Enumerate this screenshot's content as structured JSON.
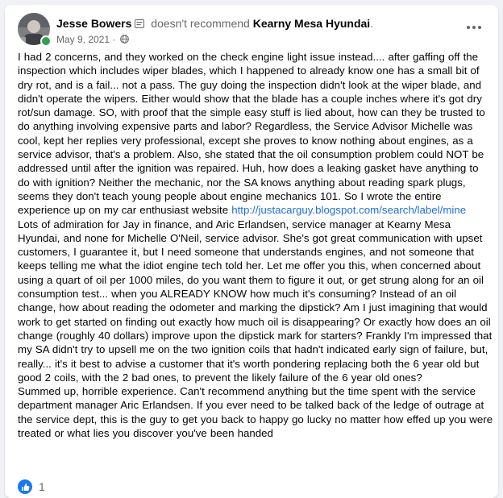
{
  "review": {
    "author": "Jesse Bowers",
    "action": "doesn't recommend",
    "business": "Kearny Mesa Hyundai",
    "date": "May 9, 2021",
    "separator": "·",
    "paragraph1_part1": "I had 2 concerns, and they worked on the check engine light issue instead.... after gaffing off the inspection which includes wiper blades, which I happened to already know one has a small bit of dry rot, and is a fail... not a pass. The guy doing the inspection didn't look at the wiper blade, and didn't operate the wipers. Either would show that the blade has a couple inches where it's got dry rot/sun damage. SO, with proof that the simple easy stuff is lied about, how can they be trusted to do anything involving expensive parts and labor? Regardless, the Service Advisor Michelle was cool, kept her replies very professional, except she proves to know nothing about engines, as a service advisor, that's a problem. Also, she stated that the oil consumption problem could NOT be addressed until after the ignition was repaired. Huh, how does a leaking gasket have anything to do with ignition? Neither the mechanic, nor the SA knows anything about reading spark plugs, seems they don't teach young people about engine mechanics 101. So I wrote the entire experience up on my car enthusiast website ",
    "link": "http://justacarguy.blogspot.com/search/label/mine",
    "paragraph1_part2": "Lots of admiration for Jay in finance, and Aric Erlandsen, service manager at Kearny Mesa Hyundai, and none for Michelle O'Neil, service advisor. She's got great communication with upset customers, I guarantee it, but I need someone that understands engines, and not someone that keeps telling me what the idiot engine tech told her. Let me offer you this, when concerned about using a quart of oil per 1000 miles, do you want them to figure it out, or get strung along for an oil consumption test... when you ALREADY KNOW how much it's consuming? Instead of an oil change, how about reading the odometer and marking the dipstick? Am I just imagining that would work to get started on finding out exactly how much oil is disappearing? Or exactly how does an oil change (roughly 40 dollars) improve upon the dipstick mark for starters? Frankly I'm impressed that my SA didn't try to upsell me on the two ignition coils that hadn't indicated early sign of failure, but, really... it's it best to advise a customer that it's worth pondering replacing both the 6 year old but good 2 coils, with the 2 bad ones, to prevent the likely failure of the 6 year old ones?",
    "paragraph2": "Summed up, horrible experience. Can't recommend anything but the time spent with the service department manager Aric Erlandsen. If you ever need to be talked back of the ledge of outrage at the service dept, this is the guy to get you back to happy go lucky no matter how effed up you were treated or what lies you discover you've been handed"
  },
  "reactions": {
    "count": "1"
  },
  "colors": {
    "link": "#216fdb",
    "like": "#1877f2",
    "online": "#31a24c"
  }
}
